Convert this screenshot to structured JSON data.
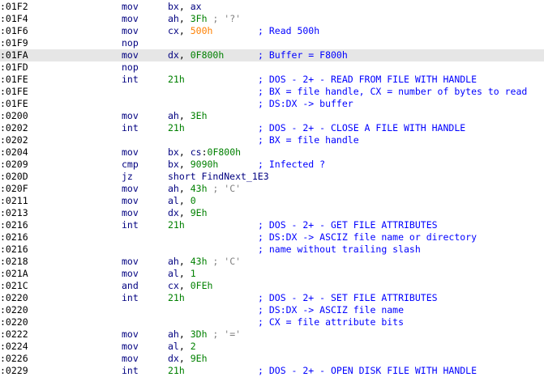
{
  "window": {
    "selected_line": 4
  },
  "colors": {
    "address": "#000000",
    "mnemonic": "#000080",
    "register": "#000080",
    "number": "#008000",
    "immediate": "#ff8000",
    "comment": "#0000ff",
    "char_comment": "#808080",
    "selection": "#e6e6e6"
  },
  "listing": [
    {
      "addr": ":01F2",
      "mnem": "mov",
      "ops": [
        [
          "reg",
          "bx"
        ],
        [
          "p",
          ", "
        ],
        [
          "reg",
          "ax"
        ]
      ],
      "cmt": ""
    },
    {
      "addr": ":01F4",
      "mnem": "mov",
      "ops": [
        [
          "reg",
          "ah"
        ],
        [
          "p",
          ", "
        ],
        [
          "num",
          "3Fh"
        ],
        [
          "gray",
          " ; '?'"
        ]
      ],
      "cmt": ""
    },
    {
      "addr": ":01F6",
      "mnem": "mov",
      "ops": [
        [
          "reg",
          "cx"
        ],
        [
          "p",
          ", "
        ],
        [
          "imm",
          "500h"
        ]
      ],
      "cmt": "; Read 500h"
    },
    {
      "addr": ":01F9",
      "mnem": "nop",
      "ops": [],
      "cmt": ""
    },
    {
      "addr": ":01FA",
      "mnem": "mov",
      "ops": [
        [
          "reg",
          "dx"
        ],
        [
          "p",
          ", "
        ],
        [
          "num",
          "0F800h"
        ]
      ],
      "cmt": "; Buffer = F800h"
    },
    {
      "addr": ":01FD",
      "mnem": "nop",
      "ops": [],
      "cmt": ""
    },
    {
      "addr": ":01FE",
      "mnem": "int",
      "ops": [
        [
          "num",
          "21h"
        ]
      ],
      "cmt": "; DOS - 2+ - READ FROM FILE WITH HANDLE"
    },
    {
      "addr": ":01FE",
      "mnem": "",
      "ops": [],
      "cmt": "; BX = file handle, CX = number of bytes to read"
    },
    {
      "addr": ":01FE",
      "mnem": "",
      "ops": [],
      "cmt": "; DS:DX -> buffer"
    },
    {
      "addr": ":0200",
      "mnem": "mov",
      "ops": [
        [
          "reg",
          "ah"
        ],
        [
          "p",
          ", "
        ],
        [
          "num",
          "3Eh"
        ]
      ],
      "cmt": ""
    },
    {
      "addr": ":0202",
      "mnem": "int",
      "ops": [
        [
          "num",
          "21h"
        ]
      ],
      "cmt": "; DOS - 2+ - CLOSE A FILE WITH HANDLE"
    },
    {
      "addr": ":0202",
      "mnem": "",
      "ops": [],
      "cmt": "; BX = file handle"
    },
    {
      "addr": ":0204",
      "mnem": "mov",
      "ops": [
        [
          "reg",
          "bx"
        ],
        [
          "p",
          ", "
        ],
        [
          "reg",
          "cs"
        ],
        [
          "p",
          ":"
        ],
        [
          "num",
          "0F800h"
        ]
      ],
      "cmt": ""
    },
    {
      "addr": ":0209",
      "mnem": "cmp",
      "ops": [
        [
          "reg",
          "bx"
        ],
        [
          "p",
          ", "
        ],
        [
          "num",
          "9090h"
        ]
      ],
      "cmt": "; Infected ?"
    },
    {
      "addr": ":020D",
      "mnem": "jz",
      "ops": [
        [
          "name",
          "short FindNext_1E3"
        ]
      ],
      "cmt": ""
    },
    {
      "addr": ":020F",
      "mnem": "mov",
      "ops": [
        [
          "reg",
          "ah"
        ],
        [
          "p",
          ", "
        ],
        [
          "num",
          "43h"
        ],
        [
          "gray",
          " ; 'C'"
        ]
      ],
      "cmt": ""
    },
    {
      "addr": ":0211",
      "mnem": "mov",
      "ops": [
        [
          "reg",
          "al"
        ],
        [
          "p",
          ", "
        ],
        [
          "num",
          "0"
        ]
      ],
      "cmt": ""
    },
    {
      "addr": ":0213",
      "mnem": "mov",
      "ops": [
        [
          "reg",
          "dx"
        ],
        [
          "p",
          ", "
        ],
        [
          "num",
          "9Eh"
        ]
      ],
      "cmt": ""
    },
    {
      "addr": ":0216",
      "mnem": "int",
      "ops": [
        [
          "num",
          "21h"
        ]
      ],
      "cmt": "; DOS - 2+ - GET FILE ATTRIBUTES"
    },
    {
      "addr": ":0216",
      "mnem": "",
      "ops": [],
      "cmt": "; DS:DX -> ASCIZ file name or directory"
    },
    {
      "addr": ":0216",
      "mnem": "",
      "ops": [],
      "cmt": "; name without trailing slash"
    },
    {
      "addr": ":0218",
      "mnem": "mov",
      "ops": [
        [
          "reg",
          "ah"
        ],
        [
          "p",
          ", "
        ],
        [
          "num",
          "43h"
        ],
        [
          "gray",
          " ; 'C'"
        ]
      ],
      "cmt": ""
    },
    {
      "addr": ":021A",
      "mnem": "mov",
      "ops": [
        [
          "reg",
          "al"
        ],
        [
          "p",
          ", "
        ],
        [
          "num",
          "1"
        ]
      ],
      "cmt": ""
    },
    {
      "addr": ":021C",
      "mnem": "and",
      "ops": [
        [
          "reg",
          "cx"
        ],
        [
          "p",
          ", "
        ],
        [
          "num",
          "0FEh"
        ]
      ],
      "cmt": ""
    },
    {
      "addr": ":0220",
      "mnem": "int",
      "ops": [
        [
          "num",
          "21h"
        ]
      ],
      "cmt": "; DOS - 2+ - SET FILE ATTRIBUTES"
    },
    {
      "addr": ":0220",
      "mnem": "",
      "ops": [],
      "cmt": "; DS:DX -> ASCIZ file name"
    },
    {
      "addr": ":0220",
      "mnem": "",
      "ops": [],
      "cmt": "; CX = file attribute bits"
    },
    {
      "addr": ":0222",
      "mnem": "mov",
      "ops": [
        [
          "reg",
          "ah"
        ],
        [
          "p",
          ", "
        ],
        [
          "num",
          "3Dh"
        ],
        [
          "gray",
          " ; '='"
        ]
      ],
      "cmt": ""
    },
    {
      "addr": ":0224",
      "mnem": "mov",
      "ops": [
        [
          "reg",
          "al"
        ],
        [
          "p",
          ", "
        ],
        [
          "num",
          "2"
        ]
      ],
      "cmt": ""
    },
    {
      "addr": ":0226",
      "mnem": "mov",
      "ops": [
        [
          "reg",
          "dx"
        ],
        [
          "p",
          ", "
        ],
        [
          "num",
          "9Eh"
        ]
      ],
      "cmt": ""
    },
    {
      "addr": ":0229",
      "mnem": "int",
      "ops": [
        [
          "num",
          "21h"
        ]
      ],
      "cmt": "; DOS - 2+ - OPEN DISK FILE WITH HANDLE"
    }
  ]
}
